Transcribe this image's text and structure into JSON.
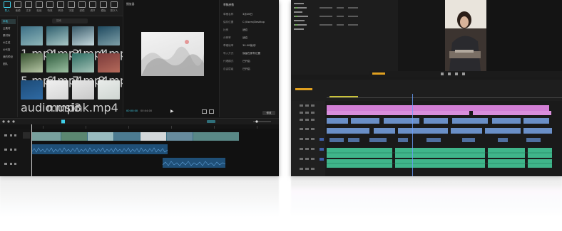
{
  "left_app": {
    "toolbar": [
      {
        "label": "导入",
        "icon": "import-icon",
        "active": true
      },
      {
        "label": "音频",
        "icon": "audio-icon"
      },
      {
        "label": "文本",
        "icon": "text-icon"
      },
      {
        "label": "贴纸",
        "icon": "sticker-icon"
      },
      {
        "label": "特效",
        "icon": "effects-icon"
      },
      {
        "label": "转场",
        "icon": "transition-icon"
      },
      {
        "label": "字幕",
        "icon": "caption-icon"
      },
      {
        "label": "滤镜",
        "icon": "filter-icon"
      },
      {
        "label": "调节",
        "icon": "adjust-icon"
      },
      {
        "label": "模板",
        "icon": "template-icon"
      },
      {
        "label": "数字人",
        "icon": "avatar-icon"
      }
    ],
    "side_items": [
      "本地",
      "云素材",
      "素材库",
      "AI生成",
      "AI代剪",
      "我的预设",
      "团队"
    ],
    "media": {
      "header": "全部",
      "search_placeholder": "搜索",
      "thumbs": [
        {
          "caption": "1.mp4",
          "color1": "#3c6f86",
          "color2": "#8fb6b8"
        },
        {
          "caption": "2.mp4",
          "color1": "#2f5f6e",
          "color2": "#a9c8c6"
        },
        {
          "caption": "3.mp4",
          "color1": "#385a6a",
          "color2": "#c6d9dd"
        },
        {
          "caption": "4.mp4",
          "color1": "#1f4a60",
          "color2": "#7fa0a8"
        },
        {
          "caption": "5.mp4",
          "color1": "#35502e",
          "color2": "#b7c7a6"
        },
        {
          "caption": "6.mp4",
          "color1": "#2d5a3c",
          "color2": "#9cc0a2"
        },
        {
          "caption": "7.mp4",
          "color1": "#2c6b61",
          "color2": "#a4c3b7"
        },
        {
          "caption": "8.mp4",
          "color1": "#7a3a3a",
          "color2": "#b56a5b"
        },
        {
          "caption": "audio.mp3",
          "color1": "#1d4b77",
          "color2": "#2f6aa3"
        },
        {
          "caption": "music",
          "color1": "#f0f0f0",
          "color2": "#d6d6d6"
        },
        {
          "caption": "ink.mp4",
          "color1": "#e6e6e6",
          "color2": "#c9c9c9"
        },
        {
          "caption": "",
          "color1": "#e9ecea",
          "color2": "#cfd6d2"
        }
      ]
    },
    "preview": {
      "title": "播放器",
      "timecode_current": "00:00:00",
      "timecode_total": "00:04:00"
    },
    "properties": {
      "title": "草稿参数",
      "rows": [
        {
          "k": "草稿名称",
          "v": "3月26日"
        },
        {
          "k": "保存位置",
          "v": "C:/Users/Desktop"
        },
        {
          "k": "比例",
          "v": "适应"
        },
        {
          "k": "分辨率",
          "v": "适应"
        },
        {
          "k": "草稿帧率",
          "v": "30.00帧/秒"
        },
        {
          "k": "导入方式",
          "v": "保留在原有位置"
        },
        {
          "k": "代理模式",
          "v": "已开启"
        },
        {
          "k": "自由层级",
          "v": "已开启"
        }
      ],
      "button": "修改"
    }
  }
}
